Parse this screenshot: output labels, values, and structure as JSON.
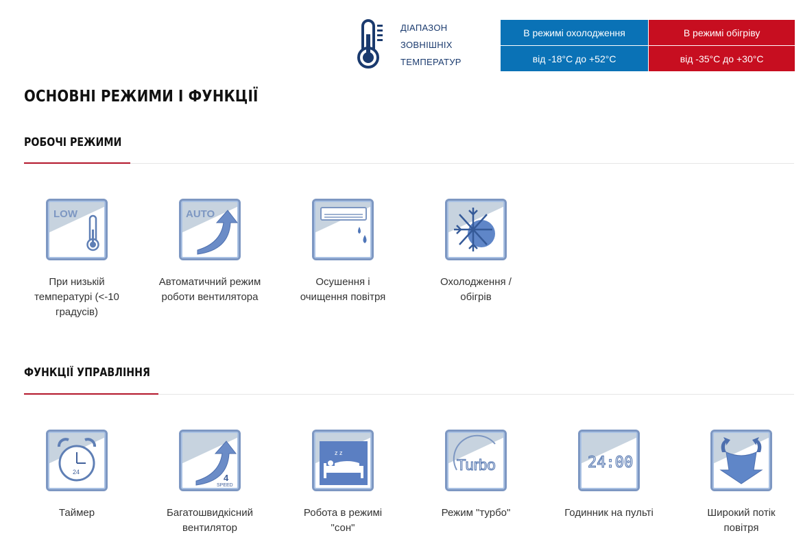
{
  "temperature_range": {
    "label_lines": [
      "ДІАПАЗОН",
      "ЗОВНІШНІХ",
      "ТЕМПЕРАТУР"
    ],
    "cooling": {
      "header": "В режимі охолодження",
      "value": "від -18°C до +52°C"
    },
    "heating": {
      "header": "В режимі обігріву",
      "value": "від -35°C до +30°C"
    },
    "colors": {
      "cooling": "#0a72b6",
      "heating": "#c70e20",
      "icon": "#1a3a6e"
    }
  },
  "page_title": "ОСНОВНІ РЕЖИМИ І ФУНКЦІЇ",
  "sections": [
    {
      "title": "РОБОЧІ РЕЖИМИ",
      "items": [
        {
          "icon": "low-temperature-icon",
          "icon_text": "LOW",
          "caption": "При низькій температурі (<-10 градусів)"
        },
        {
          "icon": "auto-fan-icon",
          "icon_text": "AUTO",
          "caption": "Автоматичний режим роботи вентилятора"
        },
        {
          "icon": "dehumidify-icon",
          "caption": "Осушення і очищення повітря"
        },
        {
          "icon": "cool-heat-icon",
          "caption": "Охолодження / обігрів"
        }
      ]
    },
    {
      "title": "ФУНКЦІЇ УПРАВЛІННЯ",
      "items": [
        {
          "icon": "timer-icon",
          "icon_text": "24",
          "caption": "Таймер"
        },
        {
          "icon": "multi-speed-fan-icon",
          "icon_text": "4",
          "icon_subtext": "SPEED",
          "caption": "Багатошвидкісний вентилятор"
        },
        {
          "icon": "sleep-mode-icon",
          "icon_text": "z z",
          "caption": "Робота в режимі \"сон\""
        },
        {
          "icon": "turbo-icon",
          "icon_text": "Turbo",
          "caption": "Режим \"турбо\""
        },
        {
          "icon": "remote-clock-icon",
          "icon_text": "24:00",
          "caption": "Годинник на пульті"
        },
        {
          "icon": "wide-airflow-icon",
          "caption": "Широкий потік повітря"
        }
      ]
    }
  ],
  "accent_color": "#b3152a"
}
